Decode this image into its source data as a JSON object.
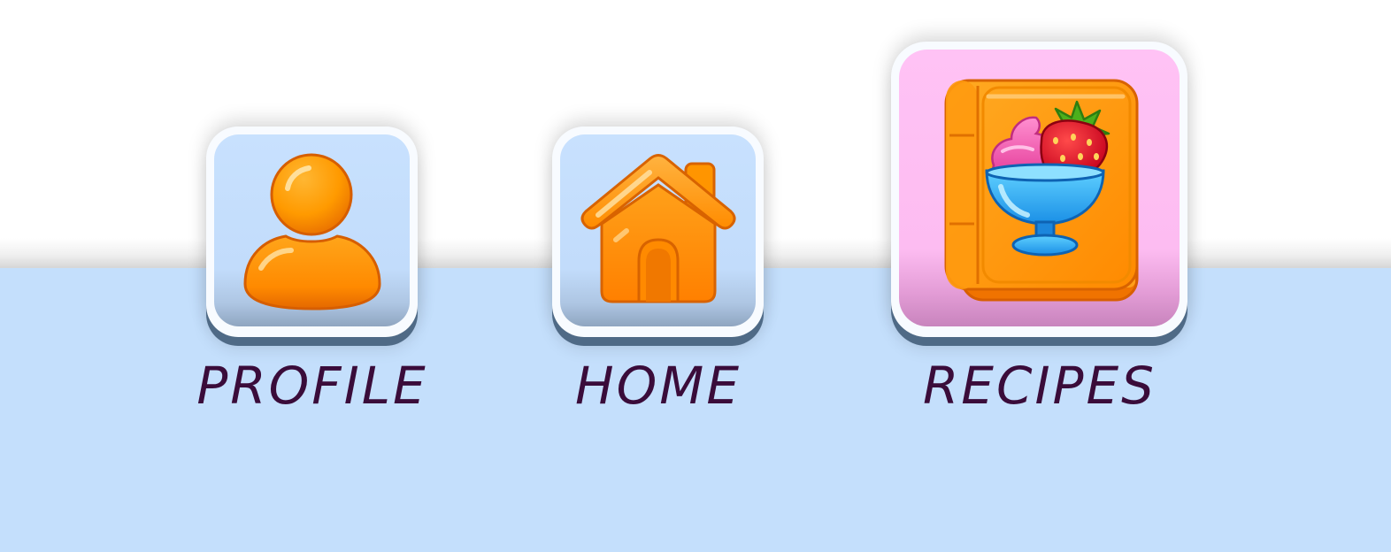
{
  "menu": {
    "items": [
      {
        "id": "profile",
        "label": "PROFILE",
        "icon": "person-icon",
        "selected": false
      },
      {
        "id": "home",
        "label": "HOME",
        "icon": "house-icon",
        "selected": false
      },
      {
        "id": "recipes",
        "label": "RECIPES",
        "icon": "recipe-book-icon",
        "selected": true
      }
    ]
  },
  "colors": {
    "background_top": "#ffffff",
    "background_bottom": "#c4dffc",
    "tile_default": "#c6dffd",
    "tile_selected": "#ffc0f4",
    "icon_orange": "#ff8c00",
    "label_text": "#3a0c3a"
  }
}
